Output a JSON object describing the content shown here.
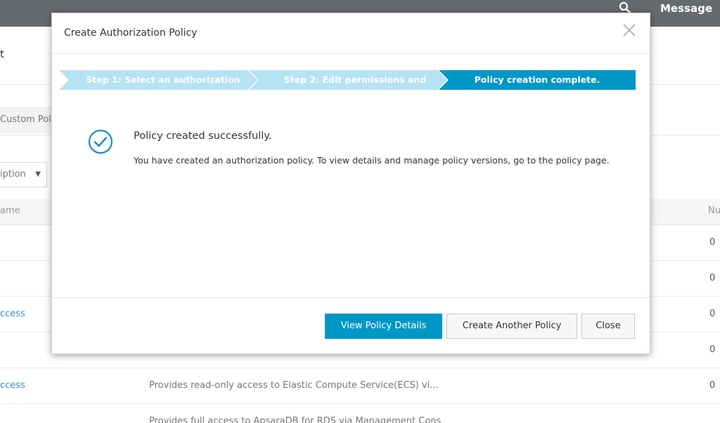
{
  "topbar": {
    "message_label": "Message",
    "search_icon": "search-icon"
  },
  "background": {
    "header_fragment": "t",
    "custom_tab_label": "Custom Poli",
    "filter_select_value": "iption",
    "table": {
      "col_name_header": "ame",
      "col_number_header": "Nu",
      "rows": [
        {
          "name": "",
          "desc": "",
          "num": "0"
        },
        {
          "name": "",
          "desc": "",
          "num": "0"
        },
        {
          "name": "ccess",
          "desc": "",
          "num": "0"
        },
        {
          "name": "",
          "desc": "",
          "num": "0"
        },
        {
          "name": "ccess",
          "desc": "Provides read-only access to Elastic Compute Service(ECS) vi...",
          "num": "0"
        },
        {
          "name": "",
          "desc": "Provides full access to ApsaraDB for RDS via Management Cons",
          "num": ""
        }
      ]
    }
  },
  "modal": {
    "title": "Create Authorization Policy",
    "close_icon": "close-icon",
    "steps": [
      {
        "label": "Step 1: Select an authorization",
        "state": "done"
      },
      {
        "label": "Step 2: Edit permissions and",
        "state": "done"
      },
      {
        "label": "Policy creation complete.",
        "state": "active"
      }
    ],
    "colors": {
      "step_done": "#b5e3f4",
      "step_active": "#0097c7",
      "primary_button": "#0097c7",
      "success_icon": "#1b8ccb"
    },
    "success": {
      "icon": "check-circle-icon",
      "title": "Policy created successfully.",
      "description": "You have created an authorization policy. To view details and manage policy versions, go to the policy page."
    },
    "buttons": {
      "view_details": "View Policy Details",
      "create_another": "Create Another Policy",
      "close": "Close"
    }
  }
}
